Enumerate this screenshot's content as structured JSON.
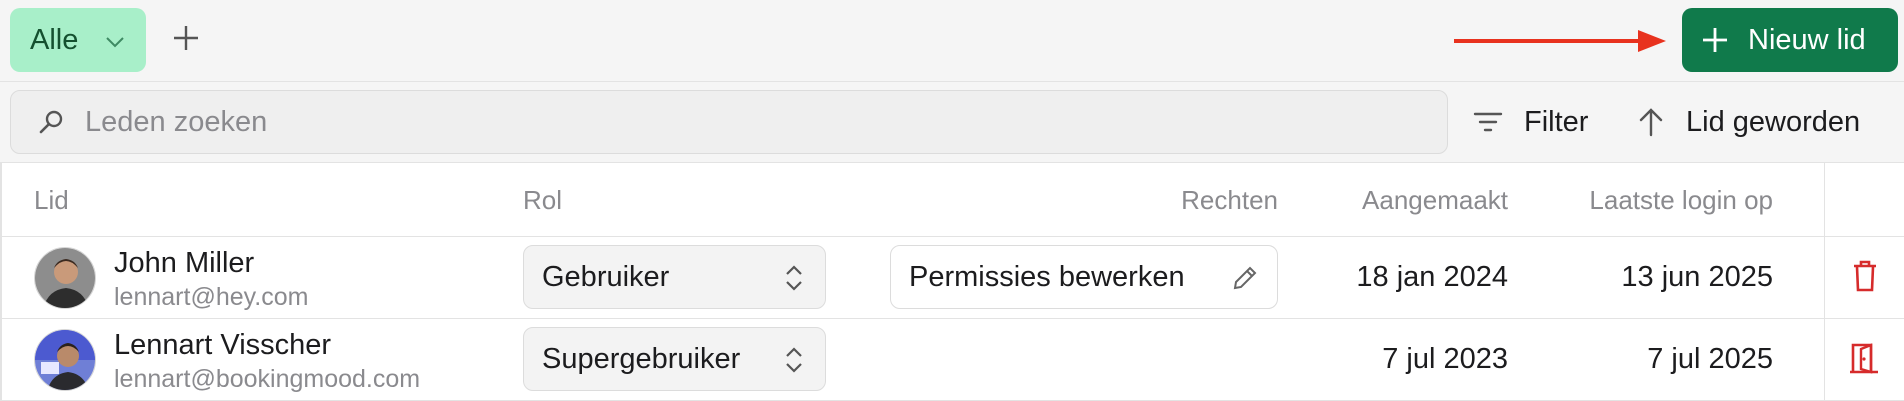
{
  "topbar": {
    "tab_label": "Alle",
    "new_member_label": "Nieuw lid"
  },
  "toolbar": {
    "search_placeholder": "Leden zoeken",
    "filter_label": "Filter",
    "sort_label": "Lid geworden"
  },
  "table": {
    "headers": {
      "member": "Lid",
      "role": "Rol",
      "rights": "Rechten",
      "created": "Aangemaakt",
      "last_login": "Laatste login op"
    },
    "rows": [
      {
        "name": "John Miller",
        "email": "lennart@hey.com",
        "role": "Gebruiker",
        "permissions_label": "Permissies bewerken",
        "created": "18 jan 2024",
        "last_login": "13 jun 2025",
        "action_icon": "trash-icon"
      },
      {
        "name": "Lennart Visscher",
        "email": "lennart@bookingmood.com",
        "role": "Supergebruiker",
        "permissions_label": "",
        "created": "7 jul 2023",
        "last_login": "7 jul 2025",
        "action_icon": "door-exit-icon"
      }
    ]
  },
  "colors": {
    "tab_bg": "#a8efc9",
    "primary_button": "#107a4b",
    "annotation_arrow": "#e8321e",
    "danger": "#d62b2b"
  }
}
